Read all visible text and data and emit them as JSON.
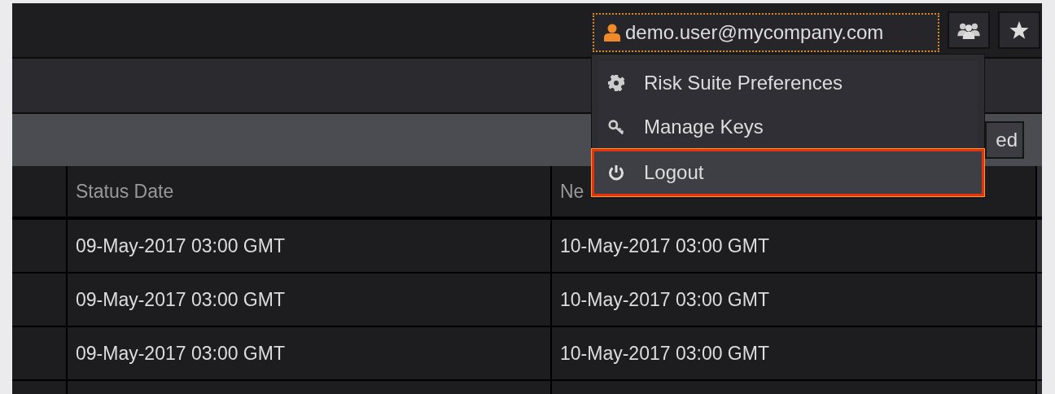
{
  "header": {
    "user": {
      "label": "demo.user@mycompany.com",
      "expanded": true
    }
  },
  "user_menu": {
    "items": [
      {
        "label": "Risk Suite Preferences",
        "selected": false
      },
      {
        "label": "Manage Keys",
        "selected": false
      },
      {
        "label": "Logout",
        "selected": true
      }
    ]
  },
  "toolbar": {
    "button": "ed"
  },
  "table": {
    "columns": [
      "Status Date",
      "Ne"
    ],
    "rows": [
      {
        "cells": [
          "09-May-2017 03:00 GMT",
          "10-May-2017 03:00 GMT"
        ]
      },
      {
        "cells": [
          "09-May-2017 03:00 GMT",
          "10-May-2017 03:00 GMT"
        ]
      },
      {
        "cells": [
          "09-May-2017 03:00 GMT",
          "10-May-2017 03:00 GMT"
        ]
      }
    ]
  }
}
